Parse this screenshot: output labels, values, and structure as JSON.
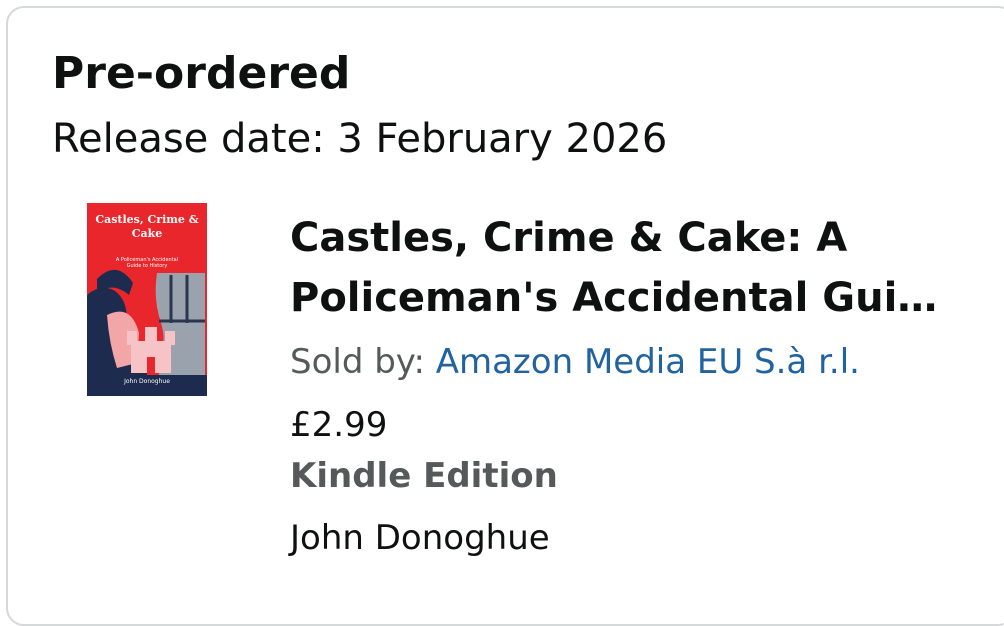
{
  "order": {
    "status": "Pre-ordered",
    "release_date": "Release date: 3 February 2026"
  },
  "item": {
    "cover": {
      "title_text": "Castles, Crime & Cake",
      "subtitle_text": "A Policeman's Accidental Guide to History",
      "author_text": "John Donoghue",
      "bg_color": "#e8262b"
    },
    "title_line1": "Castles, Crime & Cake: A",
    "title_line2": "Policeman's Accidental Gui…",
    "seller_label": "Sold by: ",
    "seller_name": "Amazon Media EU S.à r.l.",
    "price": "£2.99",
    "format": "Kindle Edition",
    "author": "John Donoghue"
  }
}
